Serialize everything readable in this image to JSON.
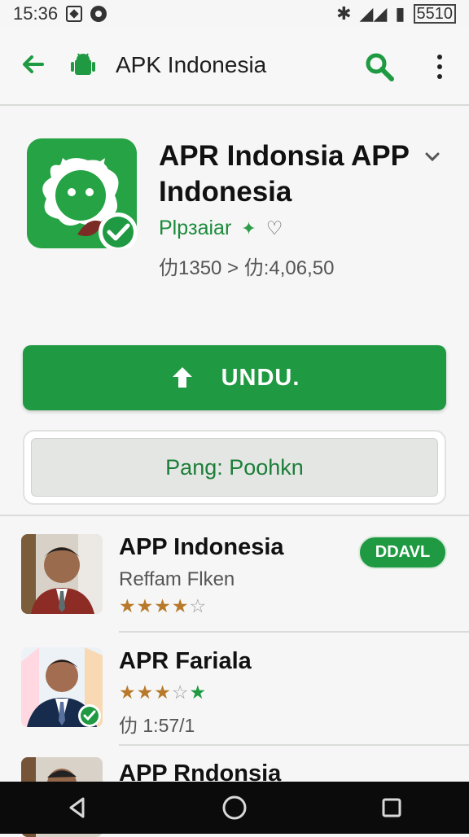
{
  "status_bar": {
    "time": "15:36",
    "battery": "5510"
  },
  "app_bar": {
    "title": "APK Indonesia"
  },
  "app_detail": {
    "name": "APR Indonsia APP Indonesia",
    "publisher": "Plpзaiar",
    "sparkle": "✦",
    "heart": "♡",
    "stats": "仂1350 > 仂:4,06,50"
  },
  "actions": {
    "download_label": "UNDU.",
    "secondary_label": "Pang: Poohkn"
  },
  "list": [
    {
      "title": "APP Indonesia",
      "subtitle": "Reffam Flken",
      "button_label": "DDAVL",
      "rating_text": "★★★★☆"
    },
    {
      "title": "APR Fariala",
      "rating_text": "★★★☆★",
      "meta": "仂 1:57/1"
    },
    {
      "title": "APP Rndonsia"
    }
  ],
  "colors": {
    "primary_green": "#1f9a42",
    "accent_gold": "#b8792a",
    "navigation_black": "#0b0b0b"
  },
  "icons": [
    "back-icon",
    "android-icon",
    "search-icon",
    "more-icon",
    "upload-icon",
    "back-nav-icon",
    "home-nav-icon",
    "recents-nav-icon"
  ]
}
